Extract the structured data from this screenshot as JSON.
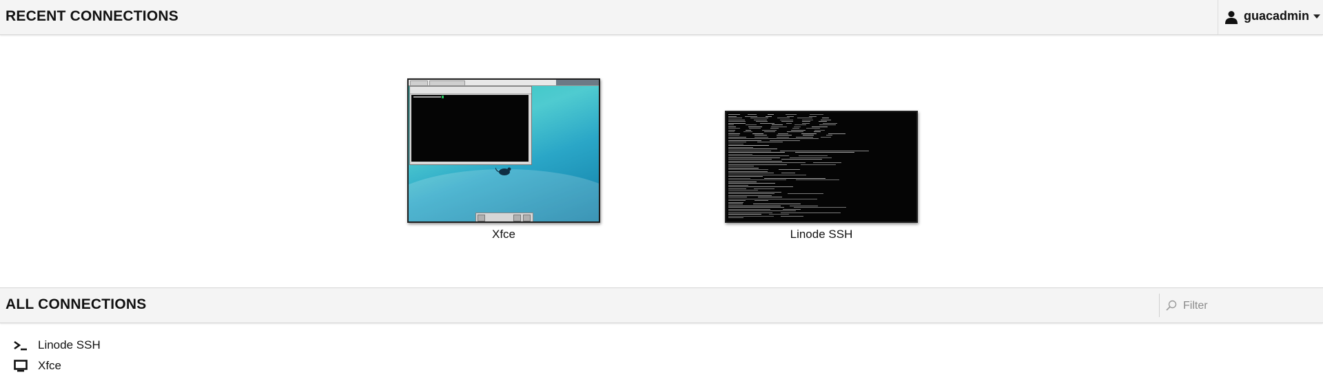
{
  "header": {
    "title": "RECENT CONNECTIONS",
    "user": {
      "name": "guacadmin",
      "icon": "user-icon",
      "caret_icon": "caret-down-icon"
    }
  },
  "recent_connections": [
    {
      "label": "Xfce",
      "thumbnail": "xfce-desktop-thumbnail"
    },
    {
      "label": "Linode SSH",
      "thumbnail": "ssh-terminal-thumbnail"
    }
  ],
  "all_connections": {
    "title": "ALL CONNECTIONS",
    "filter": {
      "placeholder": "Filter",
      "value": "",
      "icon": "search-icon"
    },
    "items": [
      {
        "label": "Linode SSH",
        "icon": "terminal-icon"
      },
      {
        "label": "Xfce",
        "icon": "desktop-icon"
      }
    ]
  }
}
